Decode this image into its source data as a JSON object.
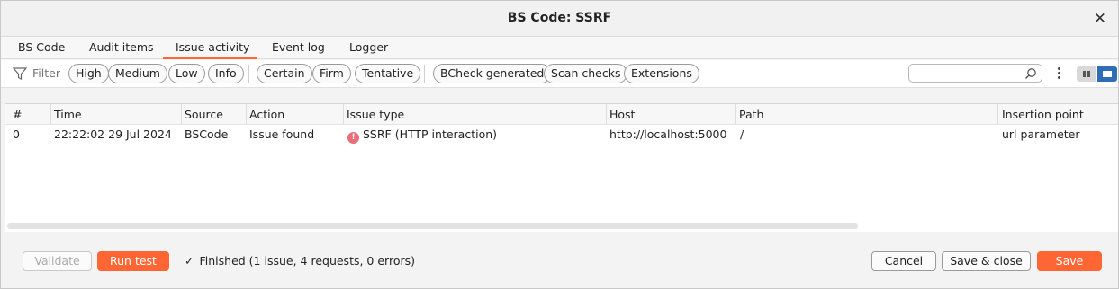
{
  "window": {
    "title": "BS Code: SSRF",
    "close_glyph": "✕"
  },
  "tabs": [
    {
      "label": "BS Code"
    },
    {
      "label": "Audit items"
    },
    {
      "label": "Issue activity",
      "active": true
    },
    {
      "label": "Event log"
    },
    {
      "label": "Logger"
    }
  ],
  "filter": {
    "label": "Filter",
    "icon": "funnel-icon",
    "severity": [
      "High",
      "Medium",
      "Low",
      "Info"
    ],
    "confidence": [
      "Certain",
      "Firm",
      "Tentative"
    ],
    "source": [
      "BCheck generated",
      "Scan checks",
      "Extensions"
    ],
    "search_placeholder": ""
  },
  "table": {
    "columns": [
      "#",
      "Time",
      "Source",
      "Action",
      "Issue type",
      "Host",
      "Path",
      "Insertion point"
    ],
    "rows": [
      {
        "num": "0",
        "time": "22:22:02 29 Jul 2024",
        "source": "BSCode",
        "action": "Issue found",
        "issue_type": "SSRF (HTTP interaction)",
        "severity_glyph": "!",
        "host": "http://localhost:5000",
        "path": "/",
        "insertion_point": "url parameter"
      }
    ]
  },
  "footer": {
    "validate_label": "Validate",
    "run_test_label": "Run test",
    "status_glyph": "✓",
    "status_text": "Finished (1 issue, 4 requests, 0 errors)",
    "cancel_label": "Cancel",
    "save_close_label": "Save & close",
    "save_label": "Save"
  },
  "colors": {
    "accent": "#ff6633",
    "severity_high": "#e8707a",
    "toggle_active": "#2f6eb5"
  }
}
